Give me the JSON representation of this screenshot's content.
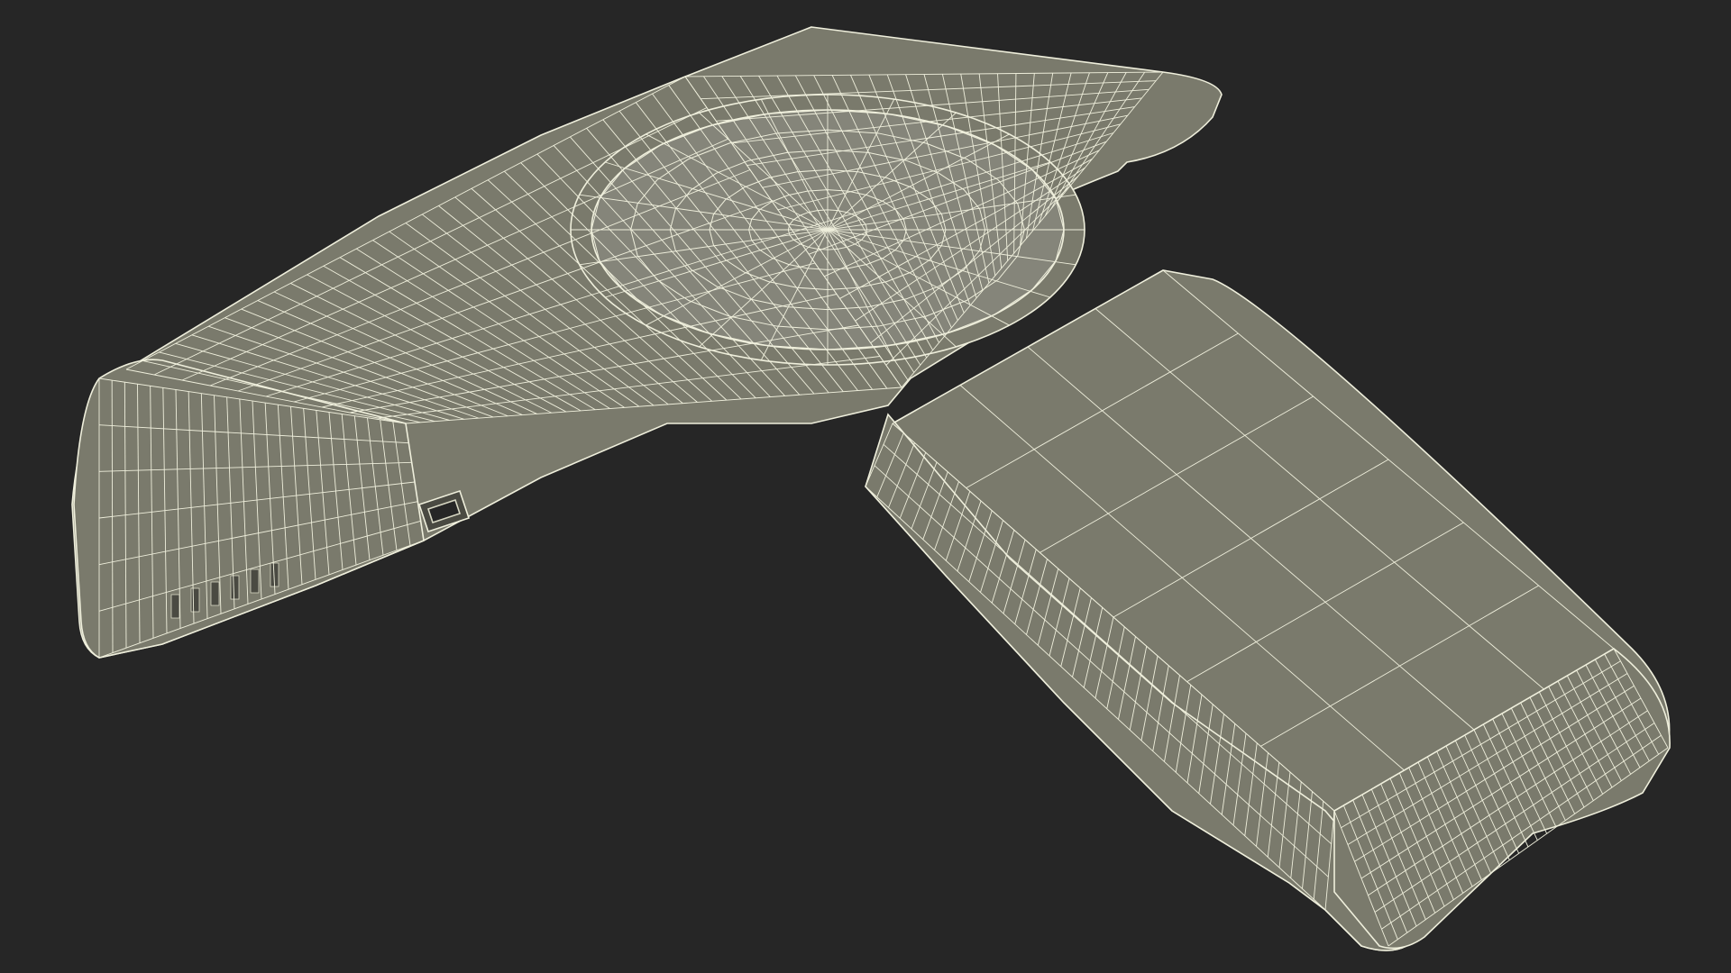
{
  "scene": {
    "subject": "",
    "colors": {
      "background": "#262626",
      "surface_fill": "#7a7a6c",
      "surface_fill_light": "#85857a",
      "wire": "#efefdc",
      "wire_dim": "#d8d8c4",
      "shadow": "#4a4a42"
    }
  }
}
